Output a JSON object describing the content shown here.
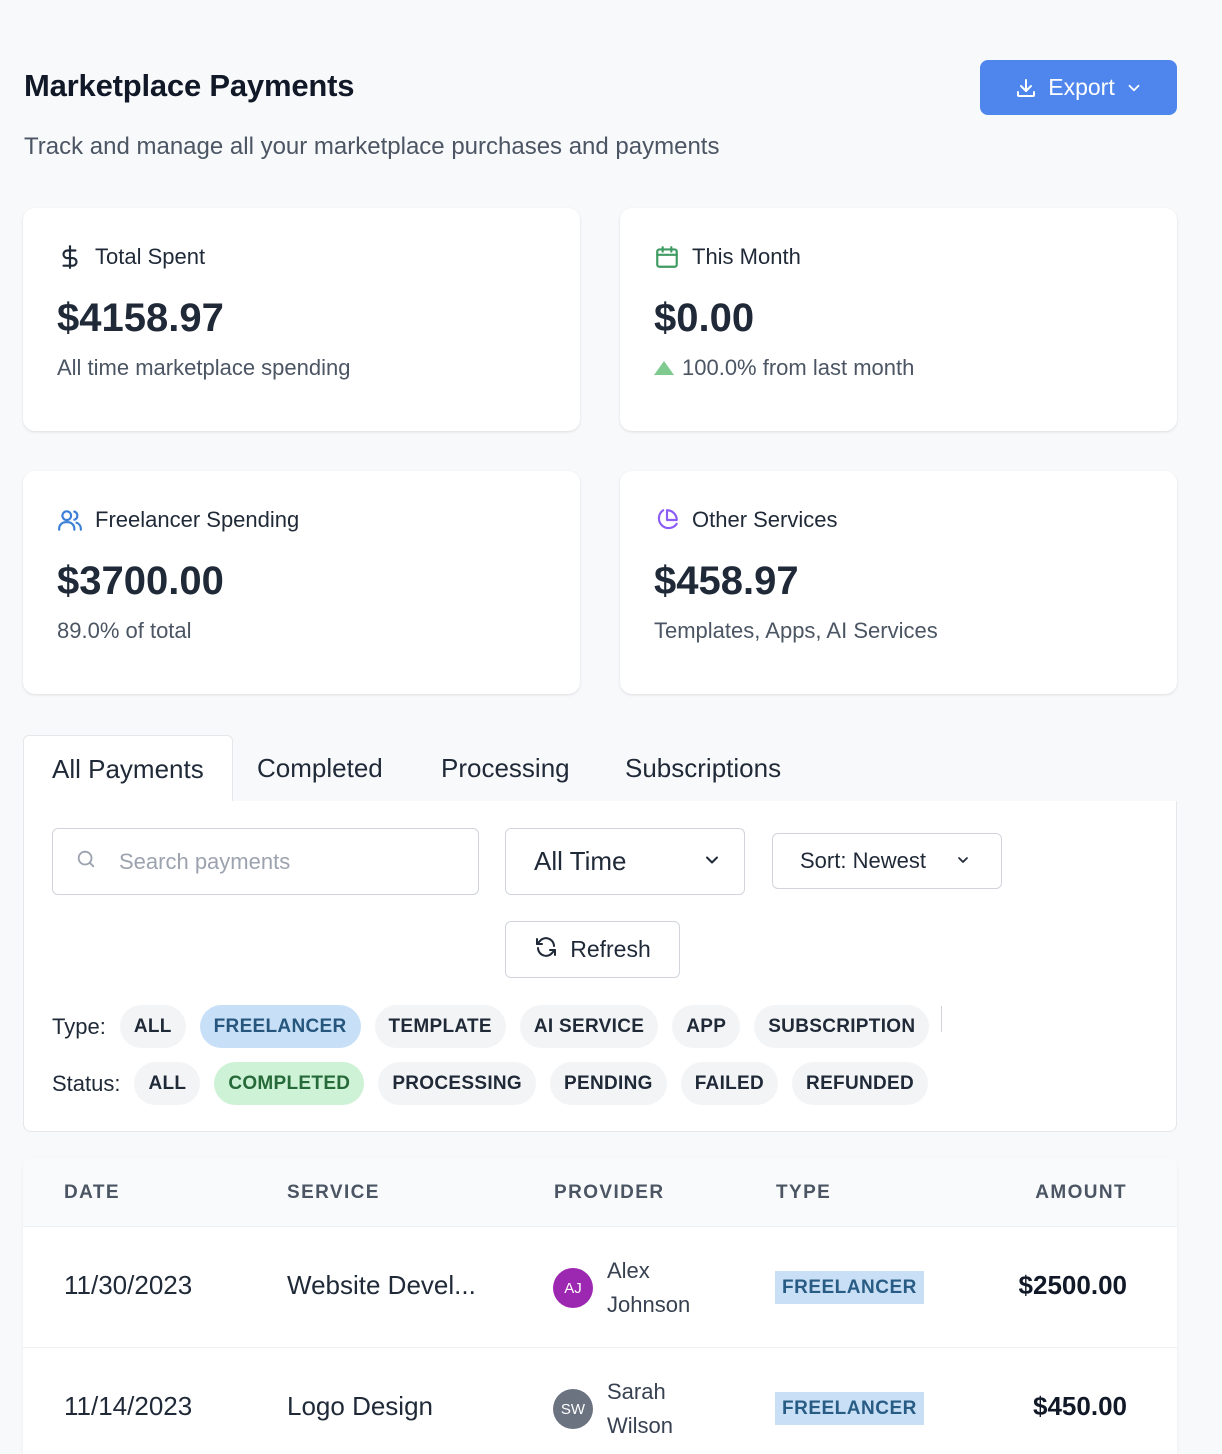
{
  "header": {
    "title": "Marketplace Payments",
    "subtitle": "Track and manage all your marketplace purchases and payments",
    "export_label": "Export"
  },
  "stats": [
    {
      "label": "Total Spent",
      "value": "$4158.97",
      "sub": "All time marketplace spending",
      "icon": "dollar-icon"
    },
    {
      "label": "This Month",
      "value": "$0.00",
      "sub": "100.0% from last month",
      "icon": "calendar-icon",
      "trend": "up"
    },
    {
      "label": "Freelancer Spending",
      "value": "$3700.00",
      "sub": "89.0% of total",
      "icon": "users-icon"
    },
    {
      "label": "Other Services",
      "value": "$458.97",
      "sub": "Templates, Apps, AI Services",
      "icon": "pie-chart-icon"
    }
  ],
  "tabs": [
    {
      "label": "All Payments",
      "active": true
    },
    {
      "label": "Completed"
    },
    {
      "label": "Processing"
    },
    {
      "label": "Subscriptions"
    }
  ],
  "filters": {
    "search_placeholder": "Search payments",
    "time_value": "All Time",
    "sort_value": "Sort: Newest",
    "refresh_label": "Refresh",
    "type_label": "Type:",
    "type_chips": [
      "ALL",
      "FREELANCER",
      "TEMPLATE",
      "AI SERVICE",
      "APP",
      "SUBSCRIPTION"
    ],
    "type_selected": "FREELANCER",
    "status_label": "Status:",
    "status_chips": [
      "ALL",
      "COMPLETED",
      "PROCESSING",
      "PENDING",
      "FAILED",
      "REFUNDED"
    ],
    "status_selected": "COMPLETED"
  },
  "table": {
    "columns": [
      "DATE",
      "SERVICE",
      "PROVIDER",
      "TYPE",
      "AMOUNT"
    ],
    "rows": [
      {
        "date": "11/30/2023",
        "service": "Website Devel...",
        "provider": "Alex Johnson",
        "initials": "AJ",
        "avatar_color": "#9c27b0",
        "type": "FREELANCER",
        "amount": "$2500.00"
      },
      {
        "date": "11/14/2023",
        "service": "Logo Design",
        "provider": "Sarah Wilson",
        "initials": "SW",
        "avatar_color": "#6b7280",
        "type": "FREELANCER",
        "amount": "$450.00"
      }
    ]
  },
  "colors": {
    "accent": "#4f86ee",
    "success": "#7fcb8f",
    "chip_selected_blue": "#c8e0f7",
    "chip_selected_green": "#cdf2d6"
  }
}
